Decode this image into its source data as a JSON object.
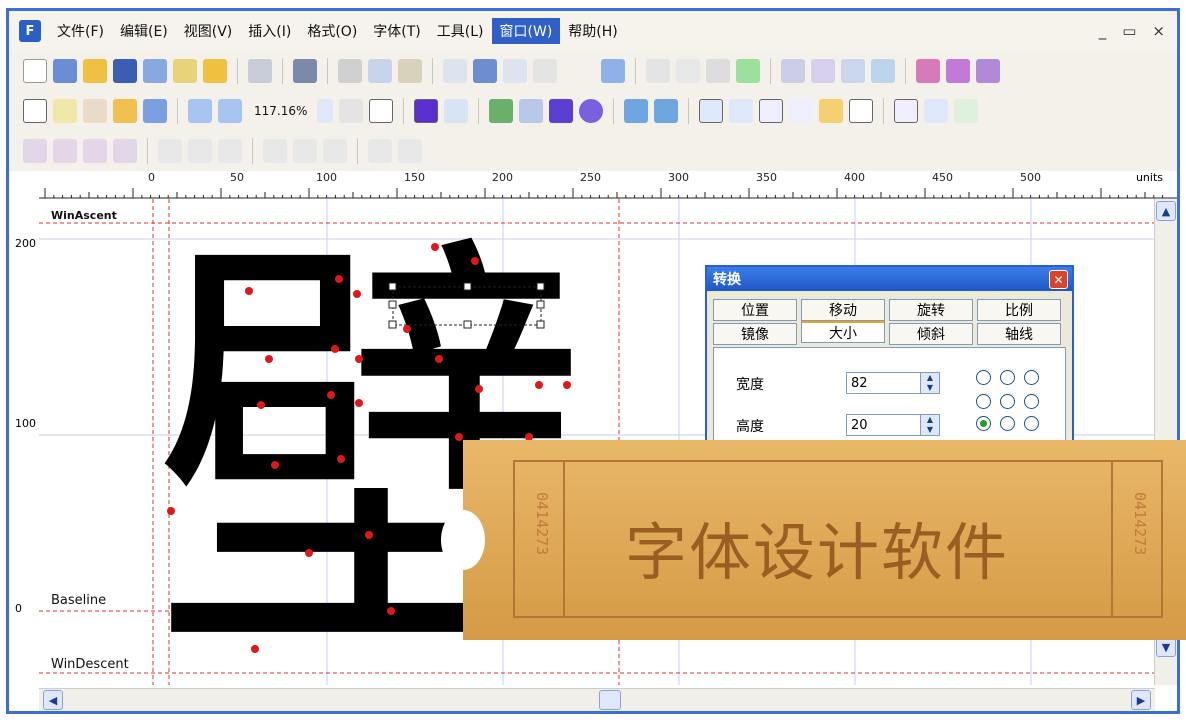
{
  "menubar": {
    "app_icon": "F",
    "items": [
      "文件(F)",
      "编辑(E)",
      "视图(V)",
      "插入(I)",
      "格式(O)",
      "字体(T)",
      "工具(L)",
      "窗口(W)",
      "帮助(H)"
    ],
    "active_index": 7,
    "window_controls": [
      "_",
      "▭",
      "×"
    ]
  },
  "toolbar": {
    "zoom": "117.16%"
  },
  "ruler": {
    "labels": [
      "0",
      "50",
      "100",
      "150",
      "200",
      "250",
      "300",
      "350",
      "400",
      "450",
      "500"
    ],
    "units": "units",
    "vertical_labels": [
      "200",
      "100",
      "0"
    ]
  },
  "guides": {
    "winascent": "WinAscent",
    "baseline": "Baseline",
    "windescent": "WinDescent"
  },
  "glyph": {
    "char": "壁"
  },
  "dialog": {
    "title": "转换",
    "tabs_row1": [
      "位置",
      "移动",
      "旋转",
      "比例"
    ],
    "tabs_row2": [
      "镜像",
      "大小",
      "倾斜",
      "轴线"
    ],
    "selected_tab": "大小",
    "width_label": "宽度",
    "width_value": "82",
    "height_label": "高度",
    "height_value": "20",
    "anchor_selected": [
      2,
      0
    ]
  },
  "overlay": {
    "text": "字体设计软件",
    "serial": "0414273"
  },
  "colors": {
    "accent": "#3a6fd8",
    "guide": "#e0302a",
    "ticket": "#dba552"
  }
}
